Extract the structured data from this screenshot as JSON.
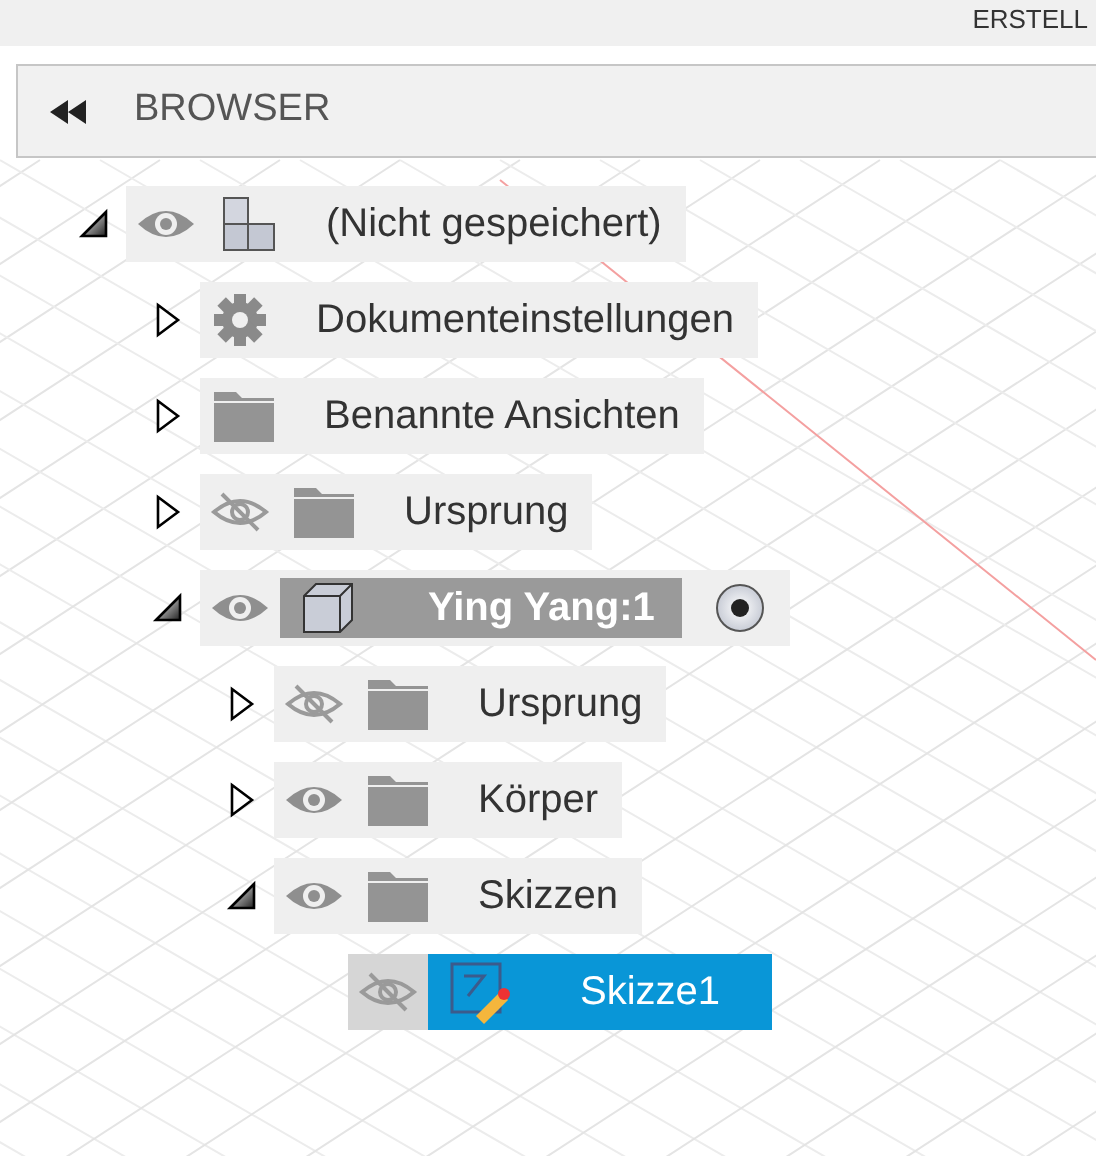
{
  "toolbar": {
    "title": "ERSTELL"
  },
  "browser": {
    "title": "BROWSER"
  },
  "tree": [
    {
      "label": "(Nicht gespeichert)",
      "kind": "document",
      "expanded": true,
      "visible": true,
      "selected": false,
      "children": [
        {
          "label": "Dokumenteinstellungen",
          "kind": "settings",
          "expanded": false,
          "selected": false
        },
        {
          "label": "Benannte Ansichten",
          "kind": "folder",
          "expanded": false,
          "selected": false
        },
        {
          "label": "Ursprung",
          "kind": "folder",
          "expanded": false,
          "visible": false,
          "selected": false
        },
        {
          "label": "Ying Yang:1",
          "kind": "component",
          "expanded": true,
          "visible": true,
          "selected": false,
          "active": true,
          "children": [
            {
              "label": "Ursprung",
              "kind": "folder",
              "expanded": false,
              "visible": false,
              "selected": false
            },
            {
              "label": "Körper",
              "kind": "folder",
              "expanded": false,
              "visible": true,
              "selected": false
            },
            {
              "label": "Skizzen",
              "kind": "folder",
              "expanded": true,
              "visible": true,
              "selected": false,
              "children": [
                {
                  "label": "Skizze1",
                  "kind": "sketch",
                  "visible": false,
                  "selected": true
                }
              ]
            }
          ]
        }
      ]
    }
  ]
}
